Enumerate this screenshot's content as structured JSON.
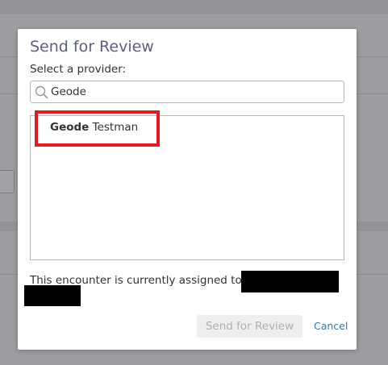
{
  "modal": {
    "title": "Send for Review",
    "select_label": "Select a provider:",
    "search": {
      "value": "Geode",
      "placeholder": ""
    },
    "providers": [
      {
        "first_name_match": "Geode",
        "last_name": "Testman",
        "selected": true
      }
    ],
    "assigned_text": "This encounter is currently assigned to",
    "send_button_label": "Send for Review",
    "send_button_enabled": false,
    "cancel_label": "Cancel"
  },
  "colors": {
    "title": "#5b5f84",
    "highlight": "#e01b22",
    "link": "#2f7bb6",
    "overlay": "#9d9ca0"
  },
  "icons": {
    "search": "search-icon"
  }
}
